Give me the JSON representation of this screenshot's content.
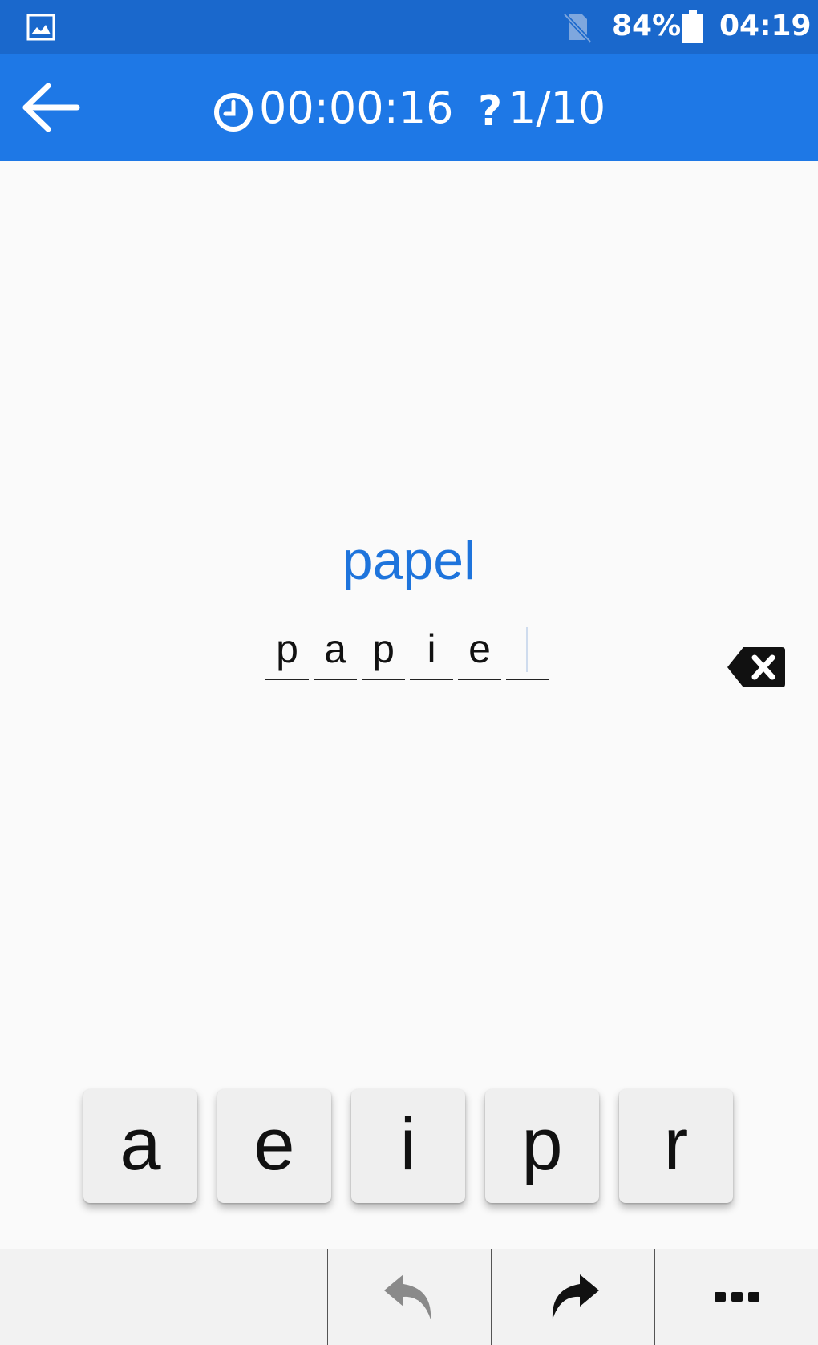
{
  "status_bar": {
    "battery_percent": "84%",
    "time": "04:19"
  },
  "app_bar": {
    "timer": "00:00:16",
    "question_icon_glyph": "?",
    "question_progress": "1/10"
  },
  "prompt": {
    "word": "papel"
  },
  "answer": {
    "slots": [
      "p",
      "a",
      "p",
      "i",
      "e",
      ""
    ]
  },
  "keys": [
    "a",
    "e",
    "i",
    "p",
    "r"
  ],
  "colors": {
    "status_bar": "#1a68cc",
    "app_bar": "#1e78e6",
    "prompt_text": "#1e74dc",
    "background": "#fafafa"
  },
  "icons": {
    "back": "arrow-left-icon",
    "timer": "clock-icon",
    "question": "question-mark-icon",
    "delete": "backspace-icon",
    "undo": "undo-icon",
    "redo": "redo-icon",
    "more": "more-horizontal-icon"
  }
}
